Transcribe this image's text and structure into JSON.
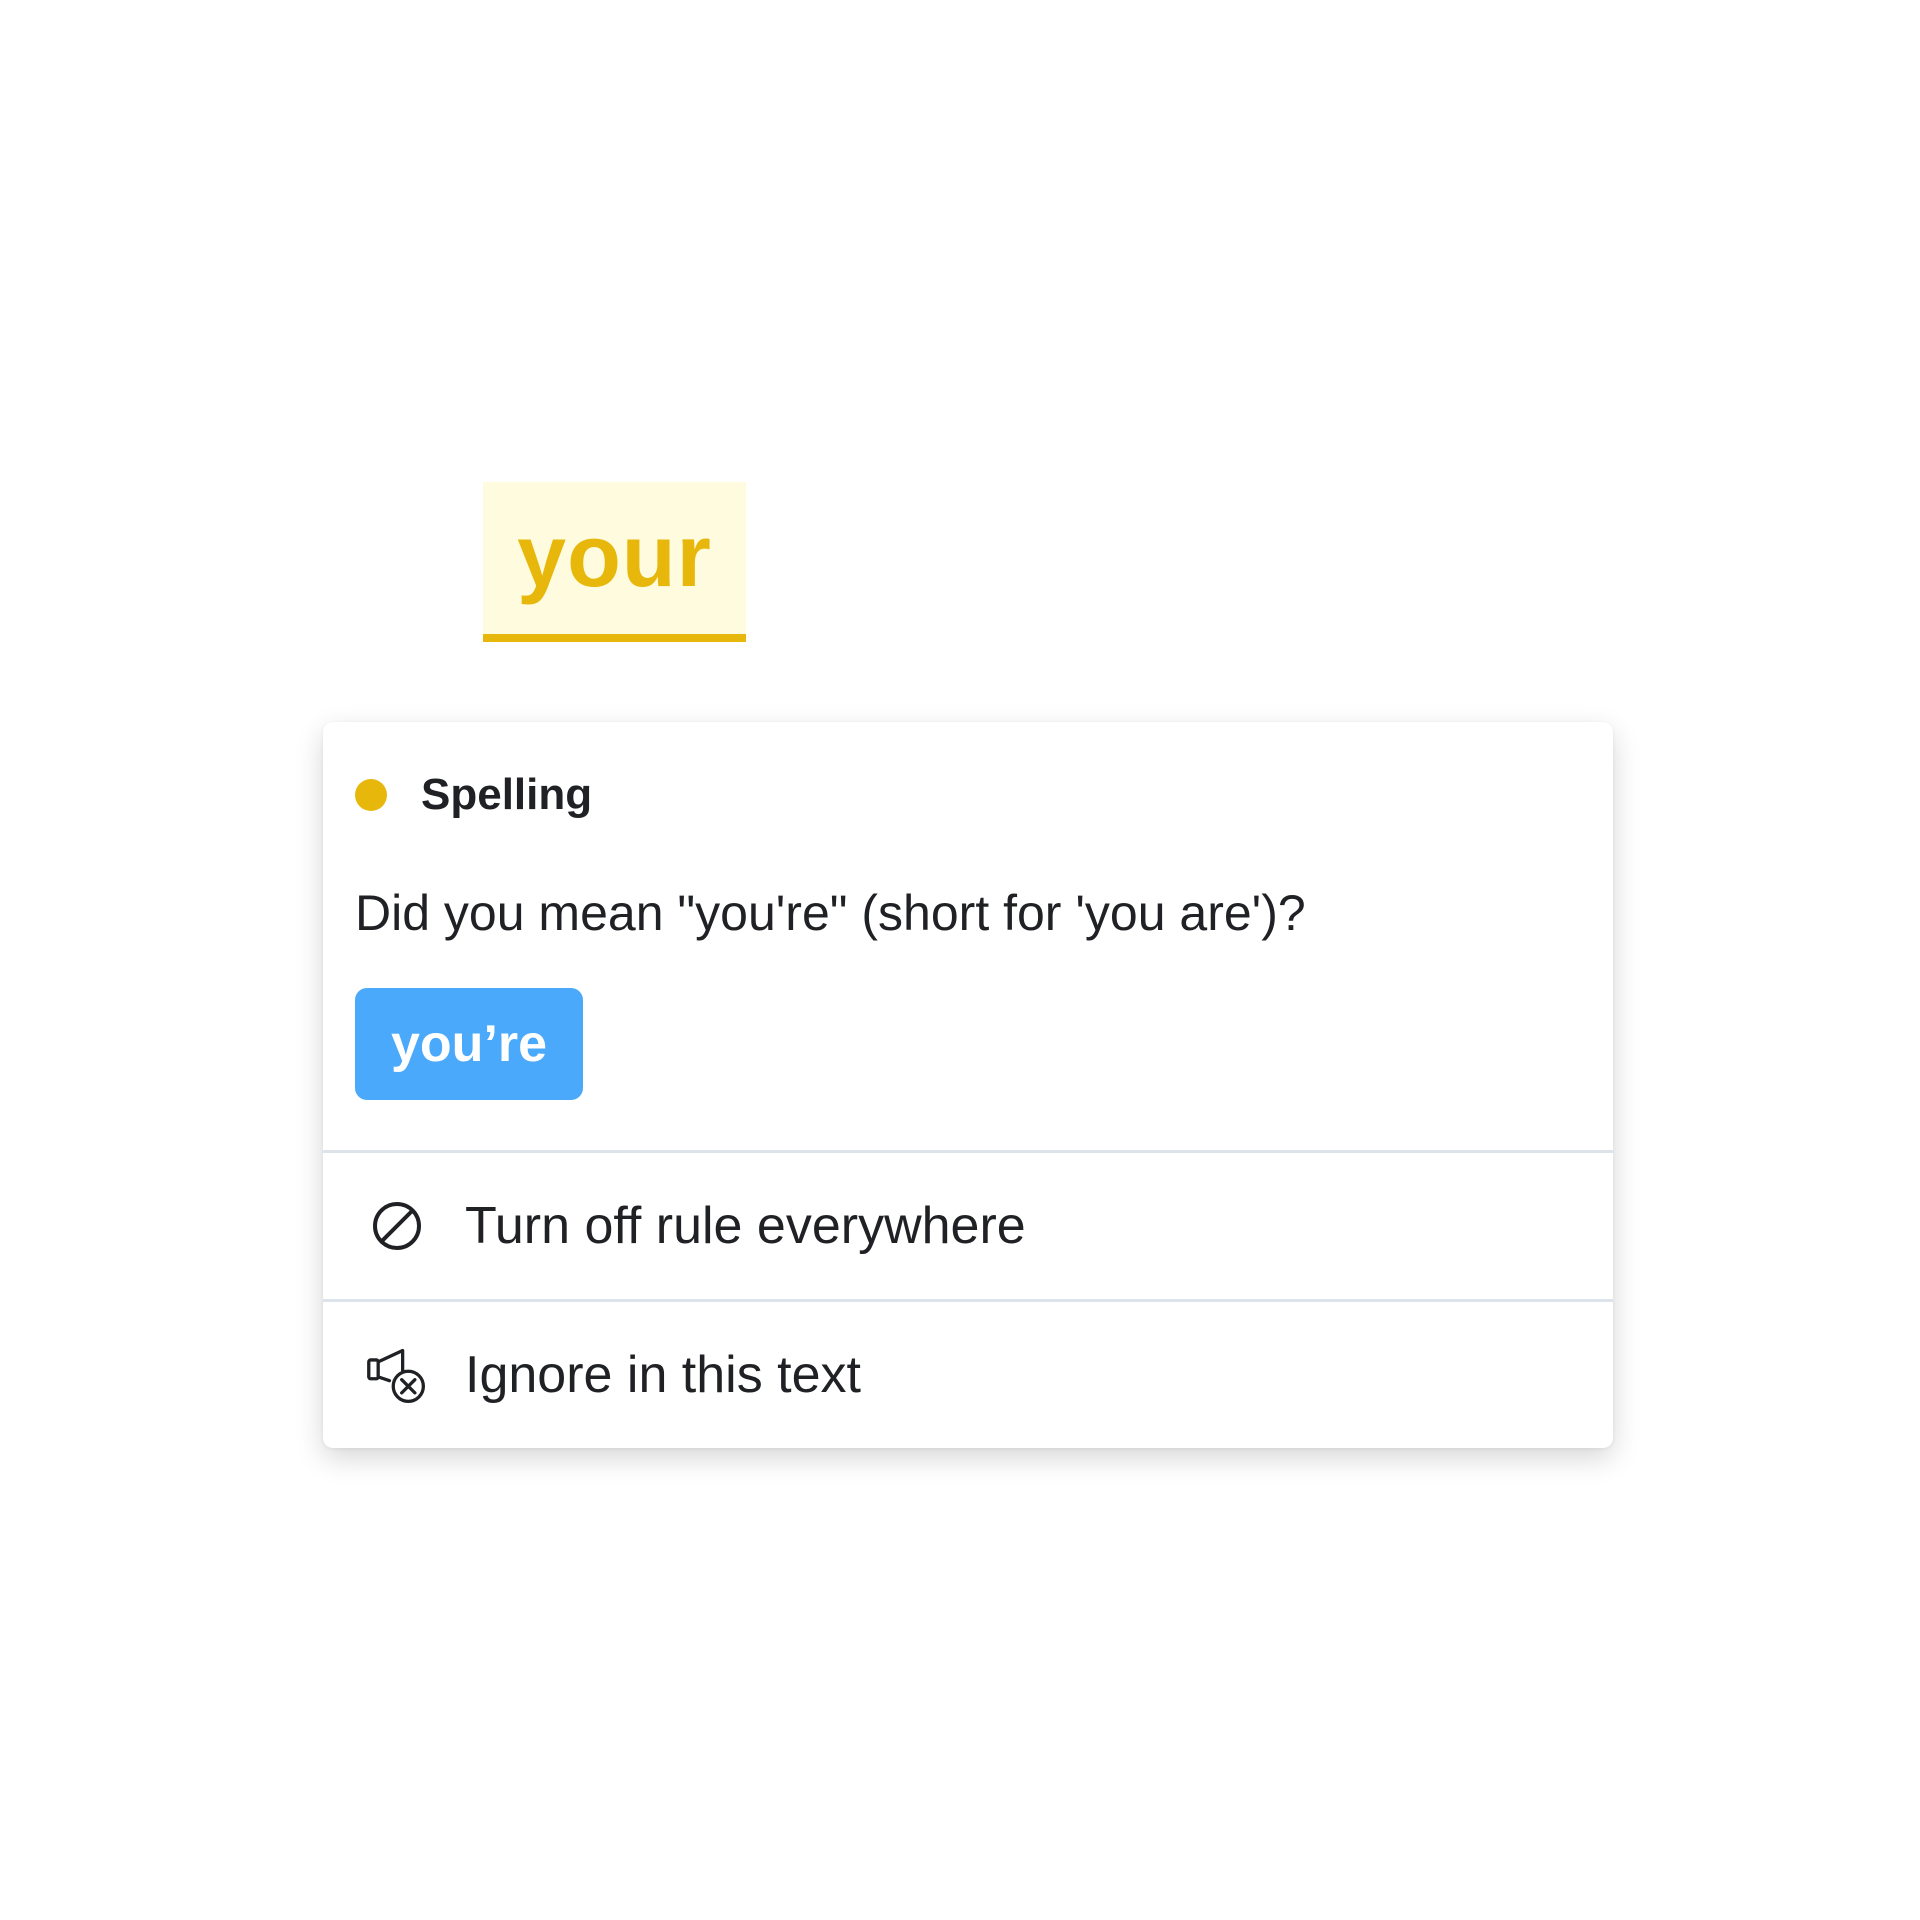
{
  "flagged_word": {
    "text": "your",
    "highlight_color": "#e7b80b",
    "background_color": "#fffbdf"
  },
  "popover": {
    "category": {
      "label": "Spelling",
      "dot_color": "#e7b80b"
    },
    "message": "Did you mean \"you're\" (short for 'you are')?",
    "suggestion": {
      "label": "you’re",
      "color": "#4aa9fb"
    },
    "actions": [
      {
        "icon": "prohibited-icon",
        "label": "Turn off rule everywhere"
      },
      {
        "icon": "ignore-megaphone-icon",
        "label": "Ignore in this text"
      }
    ]
  }
}
